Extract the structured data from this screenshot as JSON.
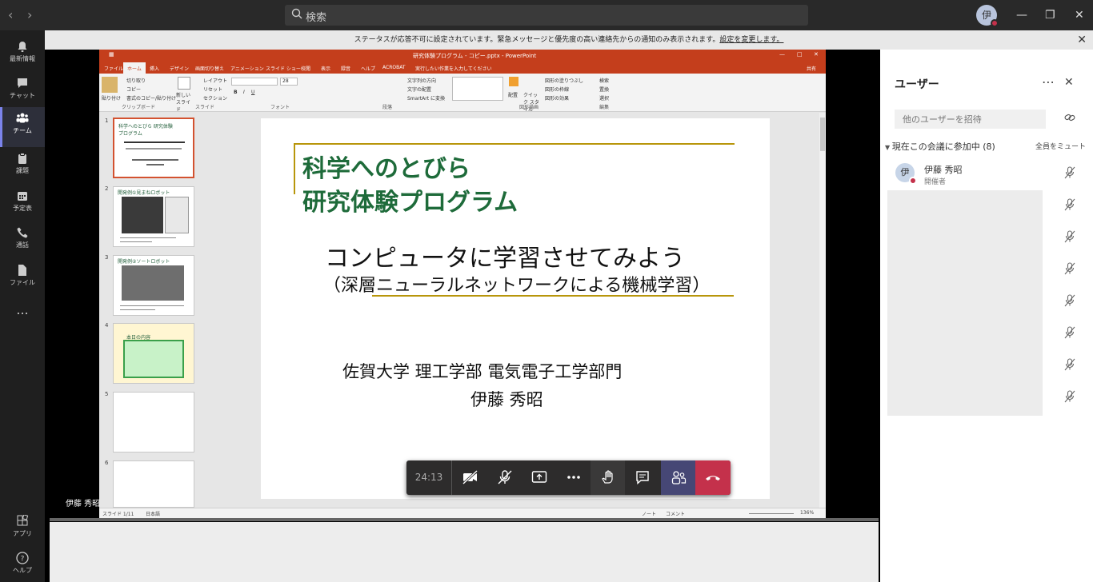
{
  "titlebar": {
    "search_placeholder": "検索",
    "user_initial": "伊"
  },
  "rail": {
    "items": [
      {
        "label": "最新情報",
        "icon": "bell-icon"
      },
      {
        "label": "チャット",
        "icon": "chat-icon"
      },
      {
        "label": "チーム",
        "icon": "teams-icon",
        "active": true
      },
      {
        "label": "課題",
        "icon": "assignments-icon"
      },
      {
        "label": "予定表",
        "icon": "calendar-icon"
      },
      {
        "label": "通話",
        "icon": "phone-icon"
      },
      {
        "label": "ファイル",
        "icon": "file-icon"
      }
    ],
    "more": "...",
    "apps_label": "アプリ",
    "help_label": "ヘルプ"
  },
  "notification": {
    "text": "ステータスが応答不可に設定されています。緊急メッセージと優先度の高い連絡先からの通知のみ表示されます。",
    "link": "設定を変更します。"
  },
  "ppt": {
    "window_title": "研究体験プログラム - コピー.pptx - PowerPoint",
    "tabs": [
      "ファイル",
      "ホーム",
      "挿入",
      "デザイン",
      "画面切り替え",
      "アニメーション",
      "スライド ショー",
      "校閲",
      "表示",
      "録音",
      "ヘルプ",
      "ACROBAT"
    ],
    "tell_me": "実行したい作業を入力してください",
    "share": "共有",
    "ribbon": {
      "paste": "貼り付け",
      "cut": "切り取り",
      "copy": "コピー",
      "format_painter": "書式のコピー/貼り付け",
      "clipboard": "クリップボード",
      "new_slide": "新しいスライド",
      "layout": "レイアウト",
      "reset": "リセット",
      "section": "セクション",
      "slides": "スライド",
      "font_size": "28",
      "font": "フォント",
      "paragraph": "段落",
      "text_direction": "文字列の方向",
      "align_text": "文字の配置",
      "smartart": "SmartArt に変換",
      "drawing": "図形描画",
      "arrange": "配置",
      "quick_styles": "クイック スタイル",
      "shape_fill": "図形の塗りつぶし",
      "shape_outline": "図形の枠線",
      "shape_effects": "図形の効果",
      "find": "検索",
      "replace": "置換",
      "select": "選択",
      "editing": "編集"
    },
    "thumbnails": [
      {
        "num": "1",
        "title": "科学へのとびら 研究体験プログラム"
      },
      {
        "num": "2",
        "title": "開発例①見まねロボット"
      },
      {
        "num": "3",
        "title": "開発例②ソートロボット"
      },
      {
        "num": "4",
        "title": "本日の内容"
      },
      {
        "num": "5",
        "title": ""
      },
      {
        "num": "6",
        "title": ""
      }
    ],
    "slide": {
      "title_line1": "科学へのとびら",
      "title_line2": "研究体験プログラム",
      "subtitle": "コンピュータに学習させてみよう",
      "subtitle2": "（深層ニューラルネットワークによる機械学習）",
      "affiliation": "佐賀大学  理工学部  電気電子工学部門",
      "presenter": "伊藤 秀昭"
    },
    "status": {
      "slide_info": "スライド 1/11",
      "language": "日本語",
      "notes": "ノート",
      "comments": "コメント",
      "zoom": "136%"
    }
  },
  "meeting": {
    "timer": "24:13",
    "presenter_name": "伊藤  秀昭"
  },
  "people_panel": {
    "title": "ユーザー",
    "invite_placeholder": "他のユーザーを招待",
    "section_title": "現在この会議に参加中 (8)",
    "mute_all": "全員をミュート",
    "participant_name": "伊藤  秀昭",
    "participant_role": "開催者",
    "participant_initial": "伊"
  }
}
